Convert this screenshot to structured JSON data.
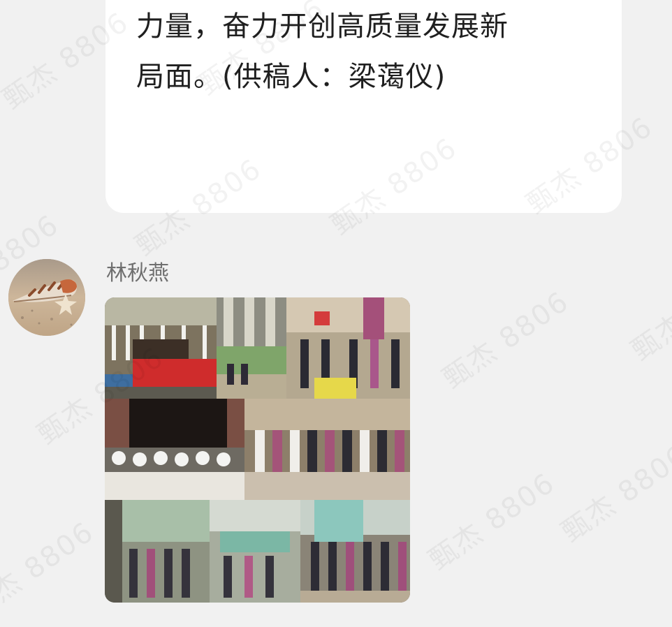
{
  "previous_message": {
    "lines": [
      "力量，奋力开创高质量发展新",
      "局面。(供稿人：梁蔼仪)"
    ]
  },
  "message": {
    "sender_name": "林秋燕",
    "avatar_icon": "seashell-on-sand-avatar",
    "image_icon": "photo-collage"
  },
  "watermark": {
    "text": "甄杰 8806"
  },
  "colors": {
    "background": "#f1f1f1",
    "bubble": "#ffffff",
    "text": "#1f1f1f",
    "sender_name": "#6f6f6f"
  }
}
